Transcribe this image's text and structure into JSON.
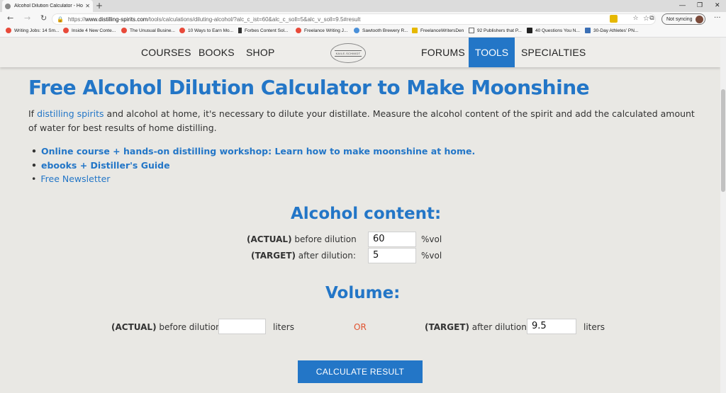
{
  "browser": {
    "tab_title": "Alcohol Dilution Calculator - Ho",
    "url_prefix": "https://",
    "url_domain": "www.distilling-spirits.com",
    "url_path": "/tools/calculations/diluting-alcohol/?alc_c_ist=60&alc_c_soll=5&alc_v_soll=9.5#result",
    "sync_label": "Not syncing",
    "bookmarks": [
      {
        "label": "Writing Jobs: 14 Sm...",
        "color": "#e84a3a"
      },
      {
        "label": "Inside 4 New Conte...",
        "color": "#e84a3a"
      },
      {
        "label": "The Unusual Busine...",
        "color": "#e84a3a"
      },
      {
        "label": "10 Ways to Earn Mo...",
        "color": "#e84a3a"
      },
      {
        "label": "Forbes Content Sol...",
        "color": "#333333"
      },
      {
        "label": "Freelance Writing J...",
        "color": "#e84a3a"
      },
      {
        "label": "Sawtooth Brewery R...",
        "color": "#4a90d9"
      },
      {
        "label": "FreelanceWritersDen",
        "color": "#e6b800"
      },
      {
        "label": "92 Publishers that P...",
        "color": "#666666"
      },
      {
        "label": "40 Questions You N...",
        "color": "#222222"
      },
      {
        "label": "30-Day Athletes' PN...",
        "color": "#3b6fb5"
      }
    ]
  },
  "nav": {
    "courses": "COURSES",
    "books": "BOOKS",
    "shop": "SHOP",
    "logo_text": "KAILE-SCHMIDT",
    "forums": "FORUMS",
    "tools": "TOOLS",
    "specialties": "SPECIALTIES"
  },
  "page": {
    "title": "Free Alcohol Dilution Calculator to Make Moonshine",
    "intro_before": "If ",
    "intro_link": "distilling spirits",
    "intro_after": " and alcohol at home, it's necessary to dilute your distillate. Measure the alcohol content of the spirit and add the calculated amount of water for best results of home distilling.",
    "links": [
      "Online course + hands-on distilling workshop: Learn how to make moonshine at home.",
      "ebooks + Distiller's Guide",
      "Free Newsletter"
    ]
  },
  "alcohol": {
    "heading": "Alcohol content:",
    "actual_strong": "(ACTUAL)",
    "actual_rest": " before dilution",
    "actual_value": "60",
    "target_strong": "(TARGET)",
    "target_rest": " after dilution:",
    "target_value": "5",
    "unit": "%vol"
  },
  "volume": {
    "heading": "Volume:",
    "actual_strong": "(ACTUAL)",
    "actual_rest": " before dilution",
    "actual_value": "",
    "or": "OR",
    "target_strong": "(TARGET)",
    "target_rest": " after dilution:",
    "target_value": "9.5",
    "unit": "liters"
  },
  "button": {
    "label": "CALCULATE RESULT"
  },
  "colors": {
    "accent": "#2376c7",
    "or_color": "#e0522f",
    "background": "#e9e8e4"
  }
}
